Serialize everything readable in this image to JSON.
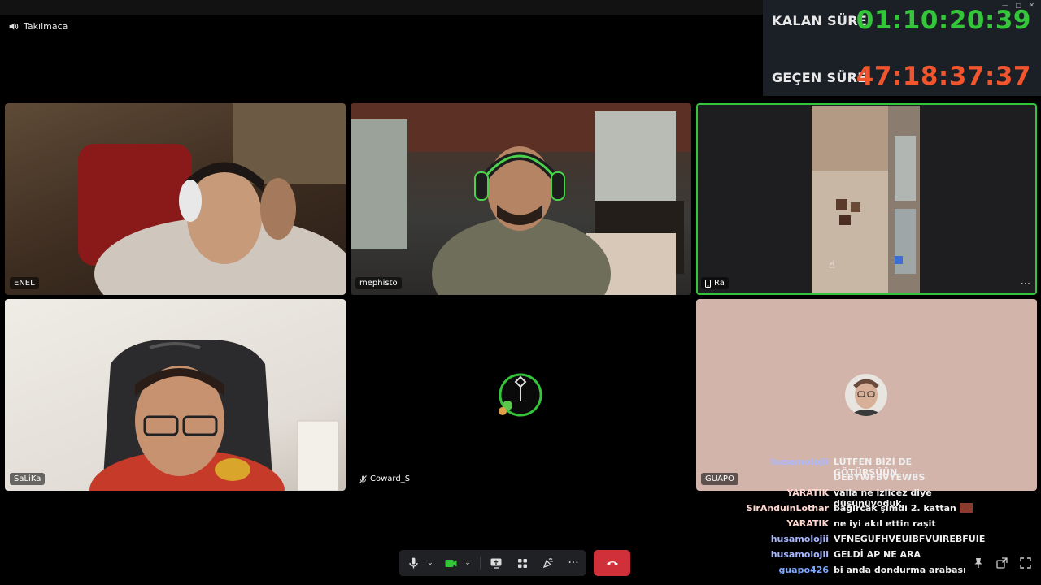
{
  "channel": {
    "name": "Takılmaca",
    "icon": "speaker-icon"
  },
  "timer": {
    "remaining_label": "KALAN SÜRE",
    "remaining_value": "01:10:20:39",
    "remaining_color": "#35c53a",
    "elapsed_label": "GEÇEN SÜRE",
    "elapsed_value": "47:18:37:37",
    "elapsed_color": "#f0552e"
  },
  "participants": [
    {
      "name": "ENEL"
    },
    {
      "name": "mephisto"
    },
    {
      "name": "Ra",
      "icon": "mobile-icon",
      "speaking": true
    },
    {
      "name": "SaLiKa"
    },
    {
      "name": "Coward_S",
      "icon": "mic-muted-icon"
    },
    {
      "name": "GUAPO"
    }
  ],
  "chat": [
    {
      "user": "husamolojii",
      "msg": "LÜTFEN BİZİ DE GÖTÜRSÜÜN",
      "color": "#a8b8ff"
    },
    {
      "user": "",
      "msg": "DEBYWFBVYEWBS",
      "color": "#a8b8ff"
    },
    {
      "user": "YARATIK",
      "msg": "valla ne izlicez diye düşünüyoduk",
      "color": "#ffd8d0"
    },
    {
      "user": "SirAnduinLothar",
      "msg": "bağırcak şimdi 2. kattan",
      "color": "#ffd8d0"
    },
    {
      "user": "YARATIK",
      "msg": "ne iyi akıl ettin raşit",
      "color": "#ffd8d0"
    },
    {
      "user": "husamolojii",
      "msg": "VFNEGUFHVEUIBFVUIREBFUIE",
      "color": "#a8b8ff"
    },
    {
      "user": "husamolojii",
      "msg": "GELDİ AP NE ARA",
      "color": "#a8b8ff"
    },
    {
      "user": "guapo426",
      "msg": "bi anda dondurma arabası",
      "color": "#7ea8ff"
    }
  ],
  "controls": {
    "mic": "microphone-icon",
    "camera": "camera-icon",
    "screen_share": "screen-share-icon",
    "activities": "activities-icon",
    "soundboard": "soundboard-icon",
    "more": "more-options-icon",
    "disconnect": "hang-up-icon",
    "accent": "#35c53a",
    "danger": "#d0303a"
  }
}
